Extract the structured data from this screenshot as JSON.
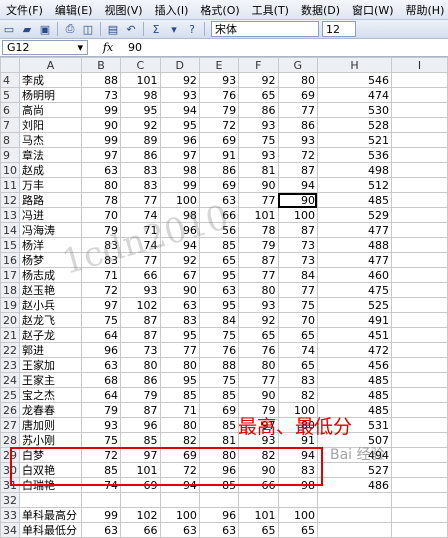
{
  "menu": [
    "文件(F)",
    "编辑(E)",
    "视图(V)",
    "插入(I)",
    "格式(O)",
    "工具(T)",
    "数据(D)",
    "窗口(W)",
    "帮助(H)"
  ],
  "toolbar": {
    "font_name": "宋体",
    "font_size": "12"
  },
  "formula_bar": {
    "cell_ref": "G12",
    "fx": "fx",
    "value": "90"
  },
  "columns": [
    "A",
    "B",
    "C",
    "D",
    "E",
    "F",
    "G",
    "H",
    "I"
  ],
  "rows": [
    {
      "n": "4",
      "a": "李成",
      "v": [
        "88",
        "101",
        "92",
        "93",
        "92",
        "80",
        "546"
      ]
    },
    {
      "n": "5",
      "a": "杨明明",
      "v": [
        "73",
        "98",
        "93",
        "76",
        "65",
        "69",
        "474"
      ]
    },
    {
      "n": "6",
      "a": "高尚",
      "v": [
        "99",
        "95",
        "94",
        "79",
        "86",
        "77",
        "530"
      ]
    },
    {
      "n": "7",
      "a": "刘阳",
      "v": [
        "90",
        "92",
        "95",
        "72",
        "93",
        "86",
        "528"
      ]
    },
    {
      "n": "8",
      "a": "马杰",
      "v": [
        "99",
        "89",
        "96",
        "69",
        "75",
        "93",
        "521"
      ]
    },
    {
      "n": "9",
      "a": "章法",
      "v": [
        "97",
        "86",
        "97",
        "91",
        "93",
        "72",
        "536"
      ]
    },
    {
      "n": "10",
      "a": "赵成",
      "v": [
        "63",
        "83",
        "98",
        "86",
        "81",
        "87",
        "498"
      ]
    },
    {
      "n": "11",
      "a": "万丰",
      "v": [
        "80",
        "83",
        "99",
        "69",
        "90",
        "94",
        "512"
      ]
    },
    {
      "n": "12",
      "a": "路路",
      "v": [
        "78",
        "77",
        "100",
        "63",
        "77",
        "90",
        "485"
      ]
    },
    {
      "n": "13",
      "a": "冯进",
      "v": [
        "70",
        "74",
        "98",
        "66",
        "101",
        "100",
        "529"
      ]
    },
    {
      "n": "14",
      "a": "冯海涛",
      "v": [
        "79",
        "71",
        "96",
        "56",
        "78",
        "87",
        "477"
      ]
    },
    {
      "n": "15",
      "a": "杨洋",
      "v": [
        "83",
        "74",
        "94",
        "85",
        "79",
        "73",
        "488"
      ]
    },
    {
      "n": "16",
      "a": "杨梦",
      "v": [
        "83",
        "77",
        "92",
        "65",
        "87",
        "73",
        "477"
      ]
    },
    {
      "n": "17",
      "a": "杨志成",
      "v": [
        "71",
        "66",
        "67",
        "95",
        "77",
        "84",
        "460"
      ]
    },
    {
      "n": "18",
      "a": "赵玉艳",
      "v": [
        "72",
        "93",
        "90",
        "63",
        "80",
        "77",
        "475"
      ]
    },
    {
      "n": "19",
      "a": "赵小兵",
      "v": [
        "97",
        "102",
        "63",
        "95",
        "93",
        "75",
        "525"
      ]
    },
    {
      "n": "20",
      "a": "赵龙飞",
      "v": [
        "75",
        "87",
        "83",
        "84",
        "92",
        "70",
        "491"
      ]
    },
    {
      "n": "21",
      "a": "赵子龙",
      "v": [
        "64",
        "87",
        "95",
        "75",
        "65",
        "65",
        "451"
      ]
    },
    {
      "n": "22",
      "a": "郭进",
      "v": [
        "96",
        "73",
        "77",
        "76",
        "76",
        "74",
        "472"
      ]
    },
    {
      "n": "23",
      "a": "王家加",
      "v": [
        "63",
        "80",
        "80",
        "88",
        "80",
        "65",
        "456"
      ]
    },
    {
      "n": "24",
      "a": "王家主",
      "v": [
        "68",
        "86",
        "95",
        "75",
        "77",
        "83",
        "485"
      ]
    },
    {
      "n": "25",
      "a": "宝之杰",
      "v": [
        "64",
        "79",
        "85",
        "85",
        "90",
        "82",
        "485"
      ]
    },
    {
      "n": "26",
      "a": "龙春春",
      "v": [
        "79",
        "87",
        "71",
        "69",
        "79",
        "100",
        "485"
      ]
    },
    {
      "n": "27",
      "a": "唐加则",
      "v": [
        "93",
        "96",
        "80",
        "85",
        "97",
        "80",
        "531"
      ]
    },
    {
      "n": "28",
      "a": "苏小刚",
      "v": [
        "75",
        "85",
        "82",
        "81",
        "93",
        "91",
        "507"
      ]
    },
    {
      "n": "29",
      "a": "白梦",
      "v": [
        "72",
        "97",
        "69",
        "80",
        "82",
        "94",
        "494"
      ]
    },
    {
      "n": "30",
      "a": "白双艳",
      "v": [
        "85",
        "101",
        "72",
        "96",
        "90",
        "83",
        "527"
      ]
    },
    {
      "n": "31",
      "a": "白瑞艳",
      "v": [
        "74",
        "69",
        "94",
        "85",
        "66",
        "98",
        "486"
      ]
    },
    {
      "n": "32",
      "a": "",
      "v": [
        "",
        "",
        "",
        "",
        "",
        "",
        ""
      ]
    },
    {
      "n": "33",
      "a": "单科最高分",
      "v": [
        "99",
        "102",
        "100",
        "96",
        "101",
        "100",
        ""
      ]
    },
    {
      "n": "34",
      "a": "单科最低分",
      "v": [
        "63",
        "66",
        "63",
        "63",
        "65",
        "65",
        ""
      ]
    }
  ],
  "annotation": "最高、最低分",
  "watermark": "1cdn2010",
  "watermark2": "Bai 经验",
  "accent_color": "#e00000"
}
